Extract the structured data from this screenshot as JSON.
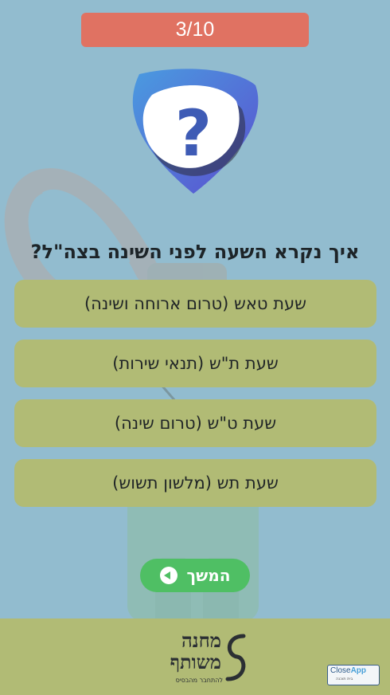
{
  "progress": {
    "label": "3/10"
  },
  "question": {
    "text": "איך נקרא השעה לפני השינה בצה\"ל?"
  },
  "answers": [
    {
      "label": "שעת טאש (טרום ארוחה ושינה)"
    },
    {
      "label": "שעת ת\"ש (תנאי שירות)"
    },
    {
      "label": "שעת ט\"ש (טרום שינה)"
    },
    {
      "label": "שעת תש (מלשון תשוש)"
    }
  ],
  "continue_button": {
    "label": "המשך"
  },
  "footer": {
    "logo_line1": "מחנה",
    "logo_line2": "משותף",
    "logo_tagline": "להתחבר מהבסיס",
    "closeapp_prefix": "Close",
    "closeapp_suffix": "App",
    "closeapp_sub": "בית תוכנה"
  },
  "colors": {
    "background": "#92bccf",
    "progress": "#e07262",
    "answer": "#b1bb75",
    "continue": "#4fbf64",
    "badge": "#5a7fd6"
  }
}
